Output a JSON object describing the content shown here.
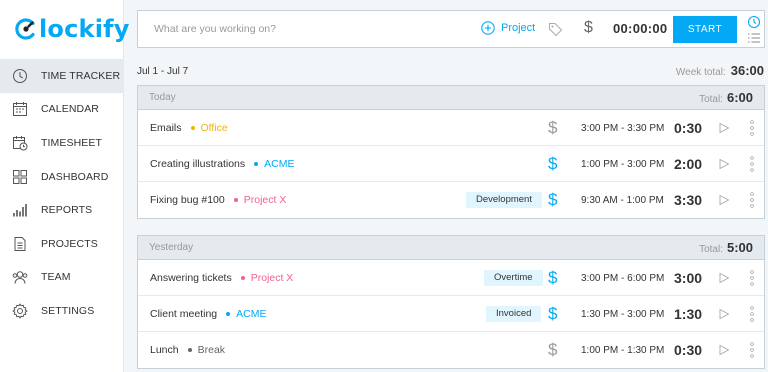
{
  "app": {
    "logo_text": "lockify"
  },
  "colors": {
    "accent": "#03a9f4",
    "office": "#f4b400",
    "acme": "#03a9f4",
    "project_x": "#f06292",
    "break": "#666666"
  },
  "sidebar": {
    "items": [
      {
        "key": "time-tracker",
        "label": "TIME TRACKER",
        "icon": "clock-icon",
        "active": true
      },
      {
        "key": "calendar",
        "label": "CALENDAR",
        "icon": "calendar-icon"
      },
      {
        "key": "timesheet",
        "label": "TIMESHEET",
        "icon": "timesheet-icon"
      },
      {
        "key": "dashboard",
        "label": "DASHBOARD",
        "icon": "dashboard-icon"
      },
      {
        "key": "reports",
        "label": "REPORTS",
        "icon": "reports-icon"
      },
      {
        "key": "projects",
        "label": "PROJECTS",
        "icon": "projects-icon"
      },
      {
        "key": "team",
        "label": "TEAM",
        "icon": "team-icon"
      },
      {
        "key": "settings",
        "label": "SETTINGS",
        "icon": "gear-icon"
      }
    ]
  },
  "tracker": {
    "placeholder": "What are you working on?",
    "project_label": "Project",
    "billable_symbol": "$",
    "timer": "00:00:00",
    "start_label": "START"
  },
  "week": {
    "range": "Jul 1 - Jul 7",
    "total_label": "Week total:",
    "total": "36:00"
  },
  "days": [
    {
      "name": "Today",
      "total_label": "Total:",
      "total": "6:00",
      "entries": [
        {
          "description": "Emails",
          "project": "Office",
          "project_color": "#f4b400",
          "tag": "",
          "billable": false,
          "range": "3:00 PM - 3:30 PM",
          "duration": "0:30"
        },
        {
          "description": "Creating illustrations",
          "project": "ACME",
          "project_color": "#03a9f4",
          "tag": "",
          "billable": true,
          "range": "1:00 PM - 3:00 PM",
          "duration": "2:00"
        },
        {
          "description": "Fixing bug #100",
          "project": "Project X",
          "project_color": "#f06292",
          "tag": "Development",
          "billable": true,
          "range": "9:30 AM - 1:00 PM",
          "duration": "3:30"
        }
      ]
    },
    {
      "name": "Yesterday",
      "total_label": "Total:",
      "total": "5:00",
      "entries": [
        {
          "description": "Answering tickets",
          "project": "Project X",
          "project_color": "#f06292",
          "tag": "Overtime",
          "billable": true,
          "range": "3:00 PM - 6:00 PM",
          "duration": "3:00"
        },
        {
          "description": "Client meeting",
          "project": "ACME",
          "project_color": "#03a9f4",
          "tag": "Invoiced",
          "billable": true,
          "range": "1:30 PM - 3:00 PM",
          "duration": "1:30"
        },
        {
          "description": "Lunch",
          "project": "Break",
          "project_color": "#666666",
          "tag": "",
          "billable": false,
          "range": "1:00 PM - 1:30 PM",
          "duration": "0:30"
        }
      ]
    }
  ]
}
